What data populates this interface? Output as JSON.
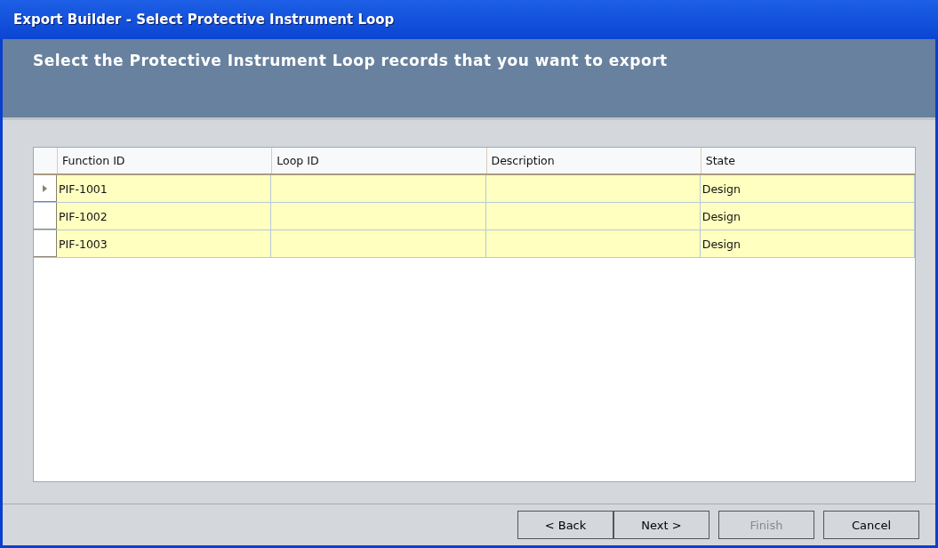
{
  "window": {
    "title": "Export Builder - Select Protective Instrument Loop"
  },
  "header": {
    "instruction": "Select the Protective Instrument Loop records that you want to export"
  },
  "table": {
    "columns": [
      "Function ID",
      "Loop ID",
      "Description",
      "State"
    ],
    "rows": [
      {
        "cells": [
          "PIF-1001",
          "",
          "",
          "Design"
        ],
        "selected": true
      },
      {
        "cells": [
          "PIF-1002",
          "",
          "",
          "Design"
        ],
        "selected": false
      },
      {
        "cells": [
          "PIF-1003",
          "",
          "",
          "Design"
        ],
        "selected": false
      }
    ]
  },
  "buttons": [
    {
      "label": "< Back",
      "disabled": false,
      "kind": "joined"
    },
    {
      "label": "Next >",
      "disabled": false,
      "kind": "joined"
    },
    {
      "label": "Finish",
      "disabled": true,
      "kind": "spaced"
    },
    {
      "label": "Cancel",
      "disabled": false,
      "kind": "spaced"
    }
  ]
}
